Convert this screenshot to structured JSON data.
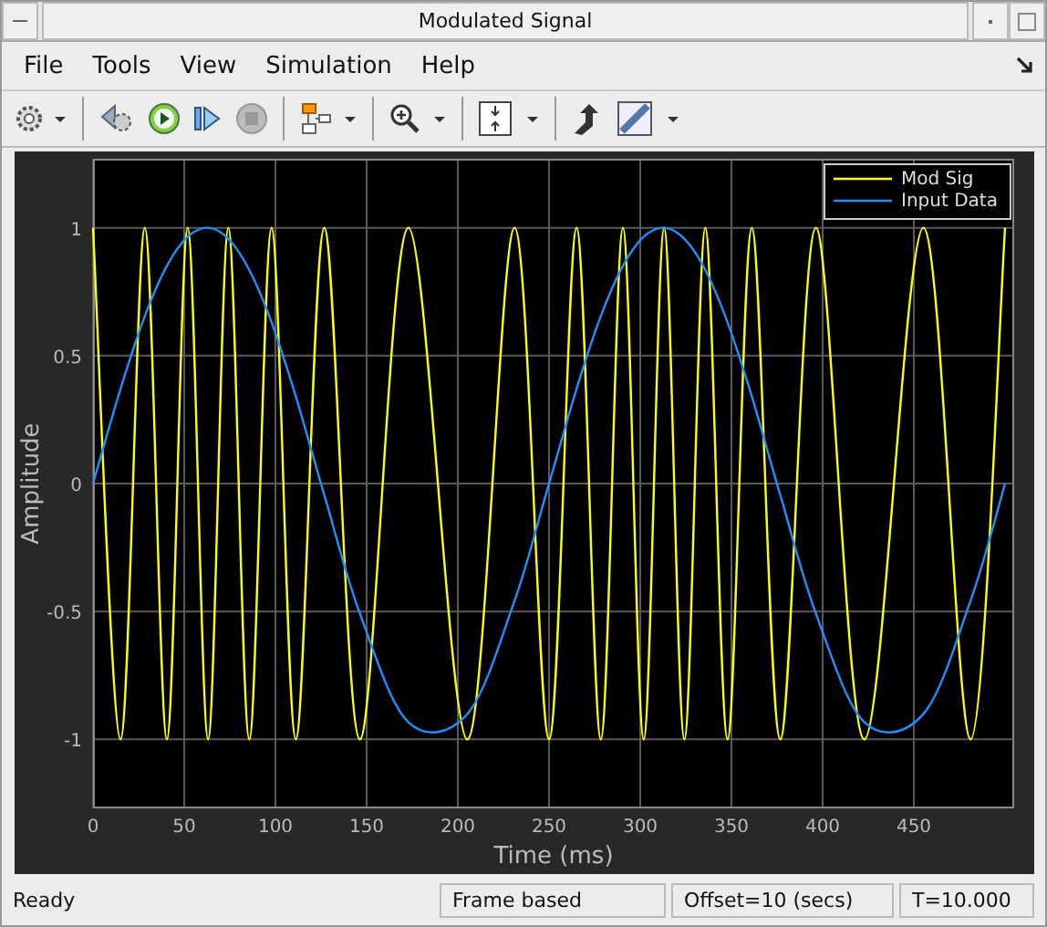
{
  "window": {
    "title": "Modulated Signal"
  },
  "menu": [
    {
      "label": "File"
    },
    {
      "label": "Tools"
    },
    {
      "label": "View"
    },
    {
      "label": "Simulation"
    },
    {
      "label": "Help"
    }
  ],
  "toolbar": {
    "stop_disabled": true
  },
  "plot": {
    "chart_data": {
      "type": "line",
      "xlabel": "Time (ms)",
      "ylabel": "Amplitude",
      "grid": true,
      "legend": true,
      "xlim": [
        0,
        505
      ],
      "ylim": [
        -1.27,
        1.27
      ],
      "xticks": [
        0,
        50,
        100,
        150,
        200,
        250,
        300,
        350,
        400,
        450
      ],
      "yticks": [
        {
          "value": -1,
          "label": "-1"
        },
        {
          "value": -0.5,
          "label": "-0.5"
        },
        {
          "value": 0,
          "label": "0"
        },
        {
          "value": 0.5,
          "label": "0.5"
        },
        {
          "value": 1,
          "label": "1"
        }
      ],
      "x": [
        0,
        15.1,
        28.4,
        40.5,
        51.9,
        63.1,
        74.2,
        85.7,
        97.9,
        111.2,
        126.8,
        146.3,
        172.9,
        205.2,
        231.1,
        250,
        265.1,
        278.4,
        290.5,
        301.9,
        313.1,
        324.2,
        335.7,
        347.9,
        361.2,
        376.8,
        396.3,
        422.9,
        455.2,
        481.1,
        500
      ],
      "series": [
        {
          "name": "Mod Sig",
          "color": "#ffff00",
          "values": [
            1,
            -1,
            1,
            -1,
            1,
            -1,
            1,
            -1,
            1,
            -1,
            1,
            -1,
            1,
            -1,
            1,
            -1,
            1,
            -1,
            1,
            -1,
            1,
            -1,
            1,
            -1,
            1,
            -1,
            1,
            -1,
            1,
            -1,
            1
          ]
        },
        {
          "name": "Input Data",
          "color": "#1e90ff",
          "values": [
            0,
            0.37,
            0.655,
            0.851,
            0.965,
            1,
            0.957,
            0.835,
            0.63,
            0.34,
            -0.045,
            -0.508,
            -0.933,
            -0.901,
            -0.458,
            0,
            0.37,
            0.655,
            0.851,
            0.965,
            1,
            0.957,
            0.835,
            0.63,
            0.34,
            -0.045,
            -0.508,
            -0.933,
            -0.901,
            -0.458,
            0
          ]
        }
      ]
    }
  },
  "status_bar": {
    "message": "Ready",
    "fields": [
      "Frame based",
      "Offset=10 (secs)",
      "T=10.000"
    ]
  }
}
